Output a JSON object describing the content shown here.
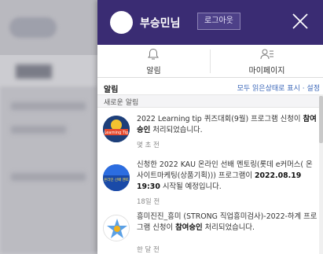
{
  "header": {
    "user_name": "부승민님",
    "logout_label": "로그아웃"
  },
  "tabs": [
    {
      "label": "알림",
      "icon": "bell-icon"
    },
    {
      "label": "마이페이지",
      "icon": "user-list-icon"
    }
  ],
  "alerts": {
    "title": "알림",
    "mark_all_read": "모두 읽은상태로 표시 · 설정",
    "section_label": "새로운 알림",
    "items": [
      {
        "text_before": "2022 Learning tip 퀴즈대회(9월) 프로그램 신청이 ",
        "bold": "참여승인",
        "text_after": " 처리되었습니다.",
        "time": "몇 초 전",
        "icon": "quiz-event-thumbnail-icon",
        "icon_text": "Learning Tip"
      },
      {
        "text_before": "신청한 2022 KAU 온라인 선배 멘토링(롯데 e커머스( 온사이트마케팅(상품기획))) 프로그램이 ",
        "bold": "2022.08.19 19:30",
        "text_after": " 시작될 예정입니다.",
        "time": "18일 전",
        "icon": "mentoring-thumbnail-icon",
        "icon_text": "온라인 선배 멘토"
      },
      {
        "text_before": "흥미진진_흥미 (STRONG 직업흥미검사)-2022-하계 프로그램 신청이 ",
        "bold": "참여승인",
        "text_after": " 처리되었습니다.",
        "time": "한 달 전",
        "icon": "interest-test-thumbnail-icon",
        "icon_text": ""
      }
    ]
  },
  "colors": {
    "header_bg": "#3a2c73",
    "link_blue": "#3a66b8"
  }
}
